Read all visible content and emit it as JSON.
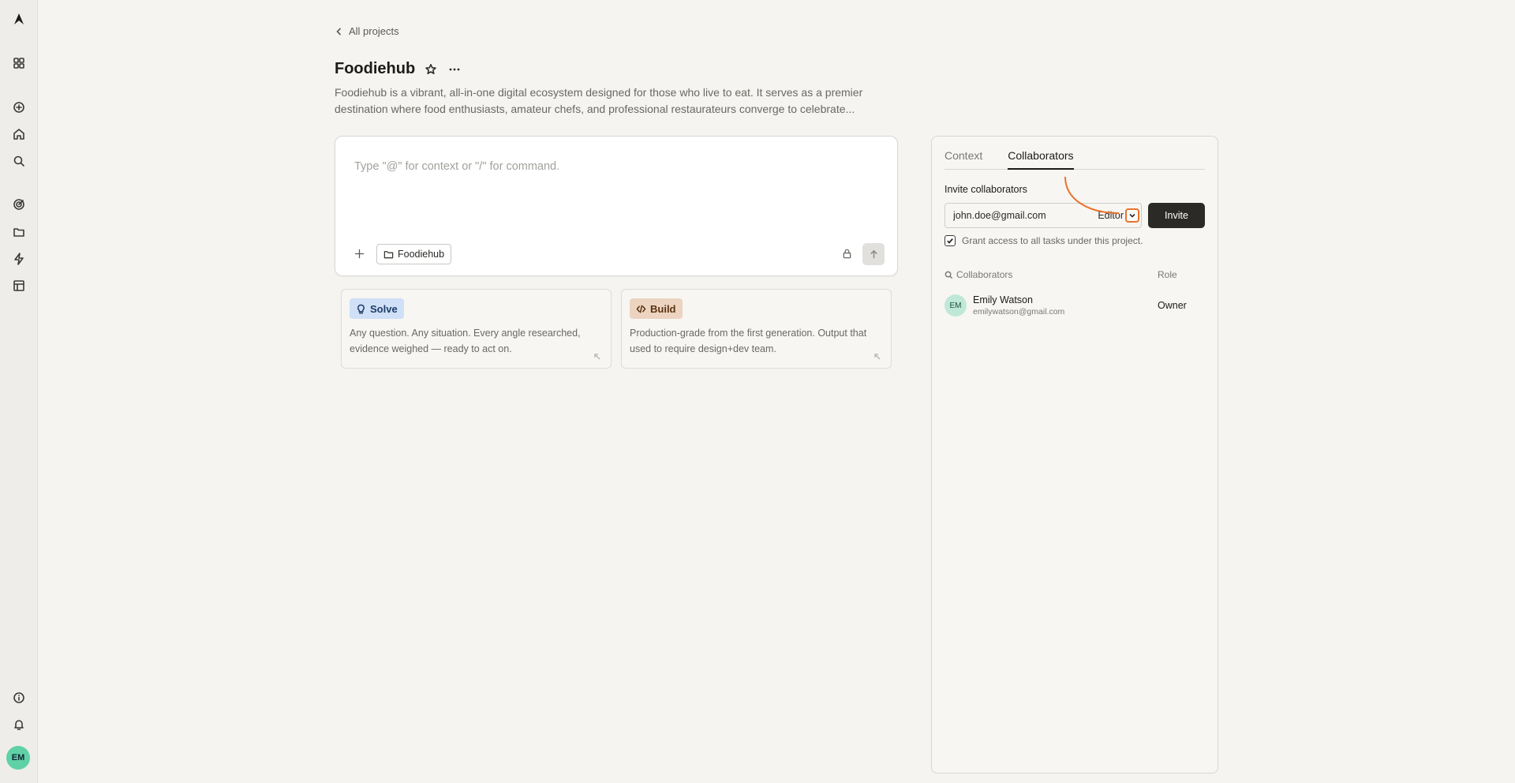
{
  "sidebar": {
    "items": [
      {
        "name": "logo-icon"
      },
      {
        "name": "apps-grid-icon"
      },
      {
        "name": "new-task-icon"
      },
      {
        "name": "home-icon"
      },
      {
        "name": "search-icon"
      },
      {
        "name": "goals-target-icon"
      },
      {
        "name": "projects-folder-icon"
      },
      {
        "name": "automations-bolt-icon"
      },
      {
        "name": "templates-layout-icon"
      },
      {
        "name": "info-icon"
      },
      {
        "name": "notifications-bell-icon"
      }
    ],
    "avatar_initials": "EM"
  },
  "breadcrumb": {
    "back_label": "All projects"
  },
  "project": {
    "title": "Foodiehub",
    "description": "Foodiehub is a vibrant, all-in-one digital ecosystem designed for those who live to eat. It serves as a premier destination where food enthusiasts, amateur chefs, and professional restaurateurs converge to celebrate..."
  },
  "composer": {
    "placeholder": "Type \"@\" for context or \"/\" for command.",
    "context_chip": "Foodiehub"
  },
  "modes": [
    {
      "label": "Solve",
      "text": "Any question. Any situation. Every angle researched, evidence weighed — ready to act on.",
      "color": "#cfe0f7",
      "text_color": "#1d3c66",
      "icon": "lightbulb-icon"
    },
    {
      "label": "Build",
      "text": "Production-grade from the first generation. Output that used to require design+dev team.",
      "color": "#ecd4c0",
      "text_color": "#5a3212",
      "icon": "code-icon"
    }
  ],
  "panel": {
    "tabs": [
      "Context",
      "Collaborators"
    ],
    "active_tab": "Collaborators",
    "invite_label": "Invite collaborators",
    "email_value": "john.doe@gmail.com",
    "role_value": "Editor",
    "invite_button": "Invite",
    "grant_label": "Grant access to all tasks under this project.",
    "grant_checked": true,
    "col_collaborators": "Collaborators",
    "col_role": "Role",
    "members": [
      {
        "initials": "EM",
        "name": "Emily Watson",
        "email": "emilywatson@gmail.com",
        "role": "Owner"
      }
    ]
  },
  "colors": {
    "accent": "#e8732a",
    "dark_button": "#2b2a27"
  }
}
